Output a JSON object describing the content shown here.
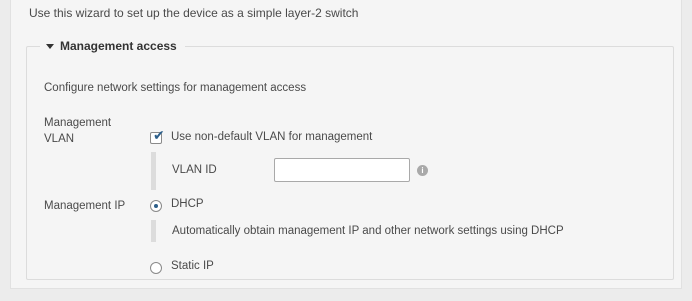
{
  "wizard": {
    "intro_text": "Use this wizard to set up the device as a simple layer-2 switch"
  },
  "management_access": {
    "section_title": "Management access",
    "description": "Configure network settings for management access",
    "vlan": {
      "label_line1": "Management",
      "label_line2": "VLAN",
      "use_non_default_label": "Use non-default VLAN for management",
      "use_non_default_checked": true,
      "vlan_id_label": "VLAN ID",
      "vlan_id_value": "",
      "info_glyph": "i"
    },
    "ip": {
      "label": "Management IP",
      "dhcp_label": "DHCP",
      "dhcp_selected": true,
      "dhcp_hint": "Automatically obtain management IP and other network settings using DHCP",
      "static_label": "Static IP",
      "static_selected": false
    }
  },
  "icons": {
    "section_toggle": "caret-down-icon",
    "vlan_id_help": "info-icon",
    "checkbox_mark": "checkmark-icon"
  },
  "colors": {
    "accent": "#2d5f8a",
    "panel_bg": "#f5f5f5",
    "page_bg": "#ececec"
  }
}
